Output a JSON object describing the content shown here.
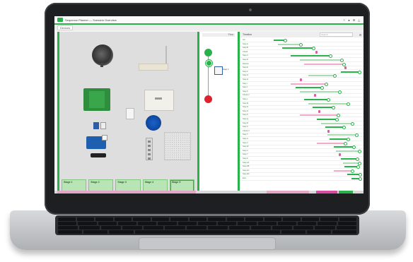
{
  "app": {
    "title_text": "Sequence Planner — Scenario Overview",
    "window_icons": [
      "help-icon",
      "user-icon",
      "settings-icon",
      "warning-icon"
    ]
  },
  "toolbar": {
    "tab_label": "Devices"
  },
  "left_panel": {
    "cards": [
      {
        "title": "Stage 1",
        "state": "done"
      },
      {
        "title": "Stage 2",
        "state": "done"
      },
      {
        "title": "Stage 3",
        "state": "done"
      },
      {
        "title": "Stage 4",
        "state": "done"
      },
      {
        "title": "Stage 5",
        "state": "active"
      }
    ]
  },
  "mid_panel": {
    "header": "Flow",
    "node_start": "",
    "node_stop": "",
    "step_label": "Step 1"
  },
  "right_panel": {
    "tab": "Timeline",
    "search_placeholder": "Search…",
    "rows": [
      {
        "label": "Init",
        "kind": "green",
        "start": 0.0,
        "end": 0.12
      },
      {
        "label": "Step A",
        "kind": "light",
        "start": 0.05,
        "end": 0.3
      },
      {
        "label": "Step B",
        "kind": "green",
        "start": 0.1,
        "end": 0.45
      },
      {
        "label": "Check",
        "kind": "none",
        "start": 0.0,
        "end": 0.0,
        "mark": 0.48
      },
      {
        "label": "Step C",
        "kind": "green",
        "start": 0.2,
        "end": 0.65
      },
      {
        "label": "Step D",
        "kind": "light",
        "start": 0.3,
        "end": 0.78
      },
      {
        "label": "Review",
        "kind": "pink",
        "start": 0.35,
        "end": 0.8
      },
      {
        "label": "Step E",
        "kind": "none",
        "start": 0.0,
        "end": 0.0,
        "mark": 0.82
      },
      {
        "label": "Step F",
        "kind": "green",
        "start": 0.78,
        "end": 0.98
      },
      {
        "label": "Step G",
        "kind": "light",
        "start": 0.4,
        "end": 0.7
      },
      {
        "label": "Step H",
        "kind": "none",
        "start": 0.0,
        "end": 0.0,
        "mark": 0.3
      },
      {
        "label": "Step I",
        "kind": "pink",
        "start": 0.2,
        "end": 0.6
      },
      {
        "label": "Step J",
        "kind": "green",
        "start": 0.25,
        "end": 0.55
      },
      {
        "label": "Step K",
        "kind": "light",
        "start": 0.3,
        "end": 0.75
      },
      {
        "label": "Check 2",
        "kind": "none",
        "start": 0.0,
        "end": 0.0,
        "mark": 0.47
      },
      {
        "label": "Step L",
        "kind": "green",
        "start": 0.35,
        "end": 0.62
      },
      {
        "label": "Step M",
        "kind": "light",
        "start": 0.4,
        "end": 0.85
      },
      {
        "label": "Step N",
        "kind": "green",
        "start": 0.45,
        "end": 0.68
      },
      {
        "label": "Step O",
        "kind": "none",
        "start": 0.0,
        "end": 0.0,
        "mark": 0.52
      },
      {
        "label": "Step P",
        "kind": "pink",
        "start": 0.3,
        "end": 0.74
      },
      {
        "label": "Step Q",
        "kind": "green",
        "start": 0.5,
        "end": 0.72
      },
      {
        "label": "Step R",
        "kind": "light",
        "start": 0.55,
        "end": 0.9
      },
      {
        "label": "Step S",
        "kind": "green",
        "start": 0.6,
        "end": 0.8
      },
      {
        "label": "Check 3",
        "kind": "none",
        "start": 0.0,
        "end": 0.0,
        "mark": 0.62
      },
      {
        "label": "Step T",
        "kind": "light",
        "start": 0.62,
        "end": 0.95
      },
      {
        "label": "Step U",
        "kind": "green",
        "start": 0.65,
        "end": 0.85
      },
      {
        "label": "Step V",
        "kind": "pink",
        "start": 0.5,
        "end": 0.82
      },
      {
        "label": "Step W",
        "kind": "green",
        "start": 0.7,
        "end": 0.92
      },
      {
        "label": "Step X",
        "kind": "light",
        "start": 0.72,
        "end": 0.98
      },
      {
        "label": "Step Y",
        "kind": "none",
        "start": 0.0,
        "end": 0.0,
        "mark": 0.75
      },
      {
        "label": "Step Z",
        "kind": "green",
        "start": 0.78,
        "end": 0.96
      },
      {
        "label": "Step AA",
        "kind": "light",
        "start": 0.8,
        "end": 0.98
      },
      {
        "label": "Step AB",
        "kind": "green",
        "start": 0.82,
        "end": 0.97
      },
      {
        "label": "Step AC",
        "kind": "pink",
        "start": 0.7,
        "end": 0.9
      },
      {
        "label": "Step AD",
        "kind": "green",
        "start": 0.85,
        "end": 0.99
      },
      {
        "label": "End",
        "kind": "green",
        "start": 0.9,
        "end": 0.99
      }
    ]
  },
  "colors": {
    "accent": "#27b34a",
    "pink": "#f3a8c7",
    "magenta": "#d94ba3",
    "stop_red": "#e0202a",
    "device_blue": "#1f5fb0"
  }
}
